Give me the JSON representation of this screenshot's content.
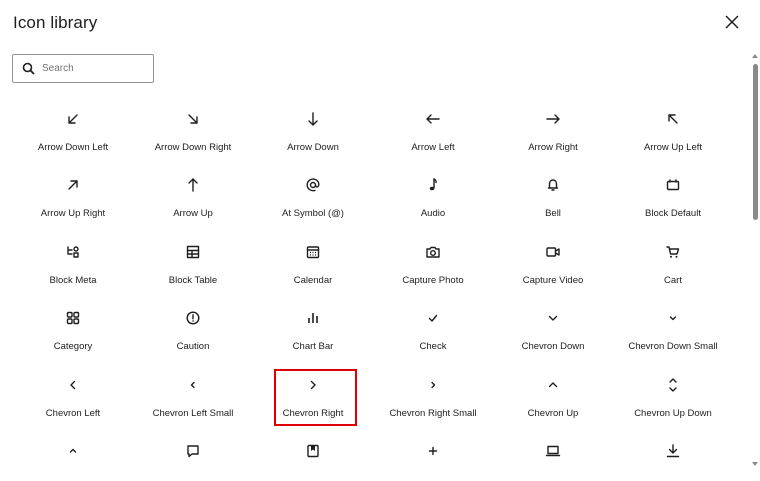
{
  "dialog": {
    "title": "Icon library",
    "close_icon": "close-icon"
  },
  "search": {
    "placeholder": "Search",
    "value": "",
    "icon": "search-icon"
  },
  "icons": [
    {
      "label": "Arrow Down Left",
      "icon": "arrow-down-left"
    },
    {
      "label": "Arrow Down Right",
      "icon": "arrow-down-right"
    },
    {
      "label": "Arrow Down",
      "icon": "arrow-down"
    },
    {
      "label": "Arrow Left",
      "icon": "arrow-left"
    },
    {
      "label": "Arrow Right",
      "icon": "arrow-right"
    },
    {
      "label": "Arrow Up Left",
      "icon": "arrow-up-left"
    },
    {
      "label": "Arrow Up Right",
      "icon": "arrow-up-right"
    },
    {
      "label": "Arrow Up",
      "icon": "arrow-up"
    },
    {
      "label": "At Symbol (@)",
      "icon": "at-symbol"
    },
    {
      "label": "Audio",
      "icon": "audio"
    },
    {
      "label": "Bell",
      "icon": "bell"
    },
    {
      "label": "Block Default",
      "icon": "block-default"
    },
    {
      "label": "Block Meta",
      "icon": "block-meta"
    },
    {
      "label": "Block Table",
      "icon": "block-table"
    },
    {
      "label": "Calendar",
      "icon": "calendar"
    },
    {
      "label": "Capture Photo",
      "icon": "capture-photo"
    },
    {
      "label": "Capture Video",
      "icon": "capture-video"
    },
    {
      "label": "Cart",
      "icon": "cart"
    },
    {
      "label": "Category",
      "icon": "category"
    },
    {
      "label": "Caution",
      "icon": "caution"
    },
    {
      "label": "Chart Bar",
      "icon": "chart-bar"
    },
    {
      "label": "Check",
      "icon": "check"
    },
    {
      "label": "Chevron Down",
      "icon": "chevron-down"
    },
    {
      "label": "Chevron Down Small",
      "icon": "chevron-down-small"
    },
    {
      "label": "Chevron Left",
      "icon": "chevron-left"
    },
    {
      "label": "Chevron Left Small",
      "icon": "chevron-left-small"
    },
    {
      "label": "Chevron Right",
      "icon": "chevron-right"
    },
    {
      "label": "Chevron Right Small",
      "icon": "chevron-right-small"
    },
    {
      "label": "Chevron Up",
      "icon": "chevron-up"
    },
    {
      "label": "Chevron Up Down",
      "icon": "chevron-up-down"
    },
    {
      "label": "",
      "icon": "chevron-up-small"
    },
    {
      "label": "",
      "icon": "comment"
    },
    {
      "label": "",
      "icon": "cover"
    },
    {
      "label": "",
      "icon": "create"
    },
    {
      "label": "",
      "icon": "desktop"
    },
    {
      "label": "",
      "icon": "download"
    }
  ],
  "highlighted_icon": "Chevron Right",
  "colors": {
    "highlight": "#e00000",
    "text": "#1e1e1e",
    "border": "#949494"
  }
}
